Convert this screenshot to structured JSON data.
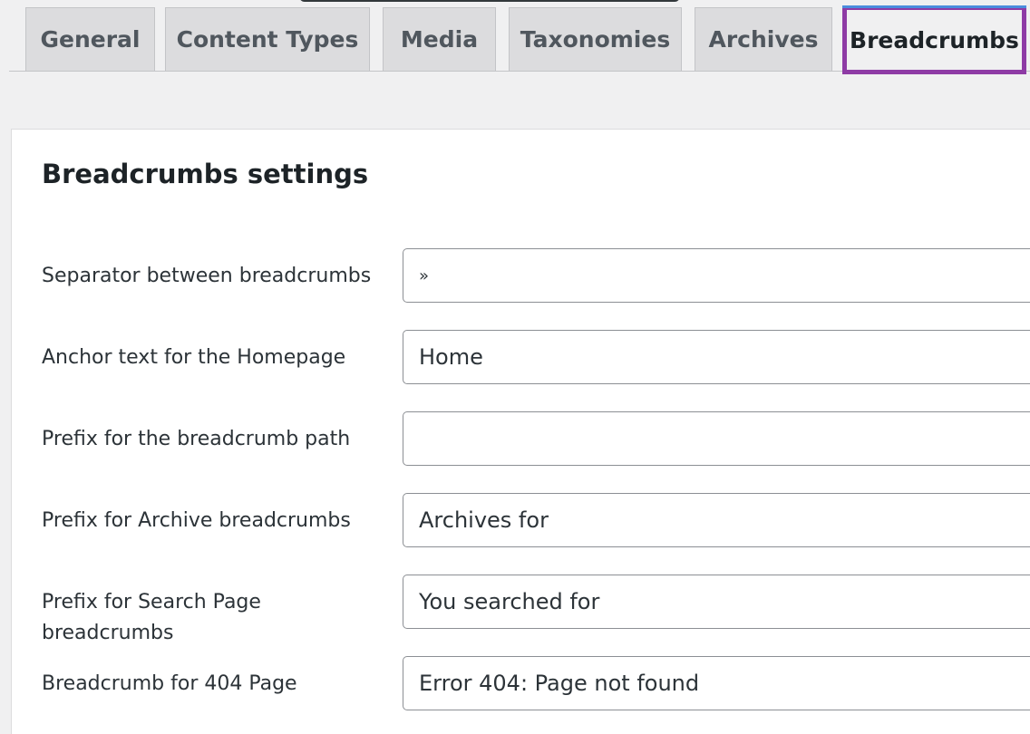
{
  "tabs": [
    {
      "label": "General"
    },
    {
      "label": "Content Types"
    },
    {
      "label": "Media"
    },
    {
      "label": "Taxonomies"
    },
    {
      "label": "Archives"
    },
    {
      "label": "Breadcrumbs",
      "active": true
    }
  ],
  "panel": {
    "title": "Breadcrumbs settings",
    "fields": [
      {
        "label": "Separator between breadcrumbs",
        "value": "»"
      },
      {
        "label": "Anchor text for the Homepage",
        "value": "Home"
      },
      {
        "label": "Prefix for the breadcrumb path",
        "value": ""
      },
      {
        "label": "Prefix for Archive breadcrumbs",
        "value": "Archives for"
      },
      {
        "label": "Prefix for Search Page breadcrumbs",
        "value": "You searched for"
      },
      {
        "label": "Breadcrumb for 404 Page",
        "value": "Error 404: Page not found"
      }
    ]
  },
  "colors": {
    "active_tab_highlight": "#8e3ba5",
    "active_tab_top": "#4a8cdd",
    "background": "#f0f0f1",
    "panel": "#ffffff"
  }
}
